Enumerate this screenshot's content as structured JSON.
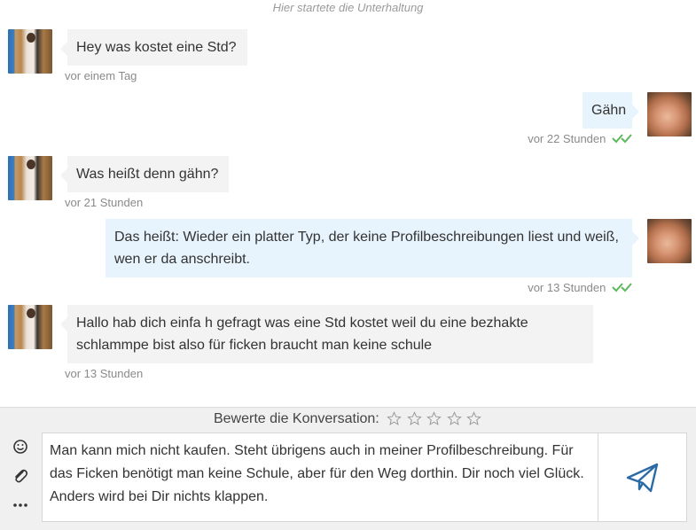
{
  "conversation": {
    "start_note": "Hier startete die Unterhaltung",
    "messages": [
      {
        "direction": "in",
        "text": "Hey was kostet eine Std?",
        "time": "vor einem Tag"
      },
      {
        "direction": "out",
        "text": "Gähn",
        "time": "vor 22 Stunden",
        "status": "read"
      },
      {
        "direction": "in",
        "text": "Was heißt denn gähn?",
        "time": "vor 21 Stunden"
      },
      {
        "direction": "out",
        "text": "Das heißt: Wieder ein platter Typ, der keine Profilbeschreibungen liest und weiß, wen er da anschreibt.",
        "time": "vor 13 Stunden",
        "status": "read"
      },
      {
        "direction": "in",
        "text": "Hallo hab dich einfa h gefragt was eine Std kostet weil du eine bezhakte schlammpe bist also für ficken braucht man keine schule",
        "time": "vor 13 Stunden"
      }
    ]
  },
  "rating": {
    "label": "Bewerte die Konversation:",
    "max_stars": 5,
    "value": 0
  },
  "composer": {
    "text": "Man kann mich nicht kaufen. Steht übrigens auch in meiner Profilbeschreibung. Für das Ficken benötigt man keine Schule, aber für den Weg dorthin. Dir noch viel Glück. Anders wird bei Dir nichts klappen.",
    "tools": [
      "smiley-icon",
      "paperclip-icon",
      "more-icon"
    ],
    "send_icon": "paper-plane-icon"
  },
  "colors": {
    "incoming_bubble": "#f3f3f3",
    "outgoing_bubble": "#e8f4fd",
    "read_check": "#5cb85c",
    "send_icon": "#2a6ba6",
    "footer_bg": "#f0f0f0"
  }
}
